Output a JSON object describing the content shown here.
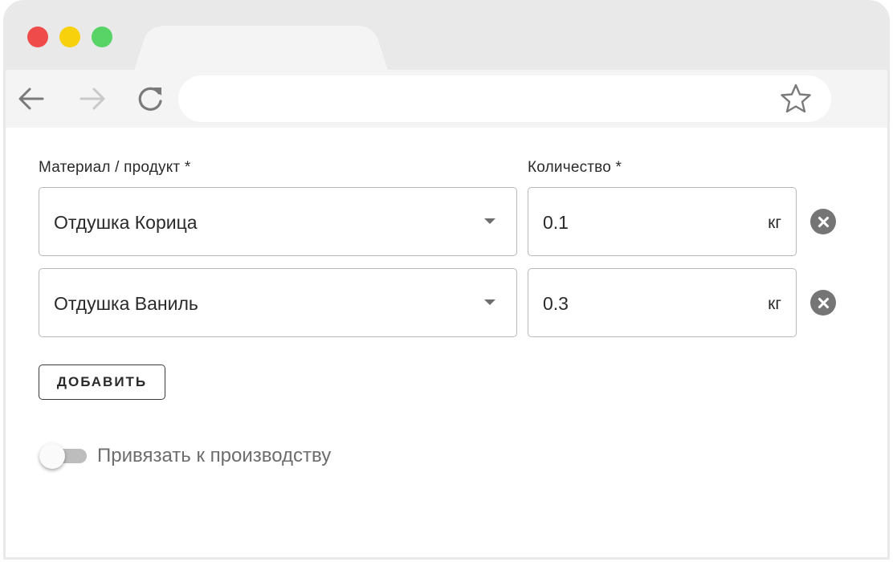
{
  "window": {
    "controls": [
      "close",
      "minimize",
      "maximize"
    ]
  },
  "toolbar": {
    "back_icon": "arrow-left-icon",
    "forward_icon": "arrow-right-icon",
    "reload_icon": "reload-icon",
    "bookmark_icon": "star-icon",
    "address": ""
  },
  "form": {
    "material_label": "Материал / продукт *",
    "quantity_label": "Количество *",
    "rows": [
      {
        "material": "Отдушка Корица",
        "quantity": "0.1",
        "unit": "кг"
      },
      {
        "material": "Отдушка Ваниль",
        "quantity": "0.3",
        "unit": "кг"
      }
    ],
    "add_button": "ДОБАВИТЬ",
    "toggle_label": "Привязать к производству",
    "toggle_on": false
  },
  "colors": {
    "close_dot": "#f04b4b",
    "minimize_dot": "#f7d10c",
    "maximize_dot": "#58d466",
    "chrome": "#e9e9e9",
    "toolbar": "#f4f4f4"
  }
}
